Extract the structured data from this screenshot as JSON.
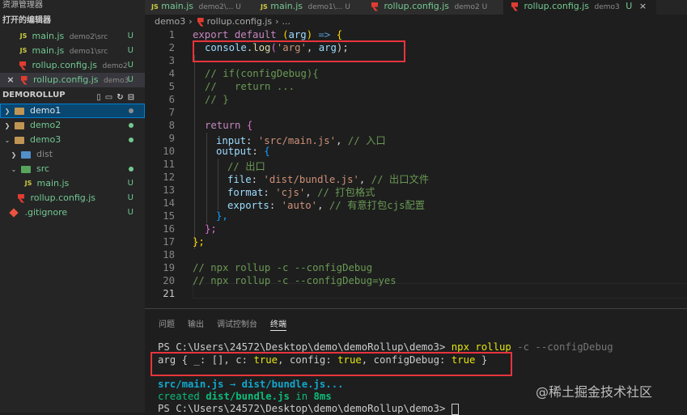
{
  "sidebar": {
    "title": "资源管理器",
    "open_editors_title": "打开的编辑器",
    "open_editors": [
      {
        "icon": "js-icon",
        "icon_text": "JS",
        "name": "main.js",
        "folder": "demo2\\src",
        "status": "U",
        "selected": false
      },
      {
        "icon": "js-icon",
        "icon_text": "JS",
        "name": "main.js",
        "folder": "demo1\\src",
        "status": "U",
        "selected": false
      },
      {
        "icon": "rollup-icon",
        "name": "rollup.config.js",
        "folder": "demo2",
        "status": "U",
        "selected": false
      },
      {
        "icon": "rollup-icon",
        "name": "rollup.config.js",
        "folder": "demo3",
        "status": "U",
        "selected": true,
        "close": "×"
      }
    ],
    "workspace_title": "DEMOROLLUP",
    "tree": [
      {
        "label": "demo1",
        "type": "folder",
        "expanded": false,
        "decoration": "dot",
        "active": true
      },
      {
        "label": "demo2",
        "type": "folder",
        "expanded": false,
        "decoration": "dot"
      },
      {
        "label": "demo3",
        "type": "folder",
        "expanded": true,
        "decoration": "dot"
      },
      {
        "label": "dist",
        "type": "folder",
        "expanded": false,
        "decoration": ""
      },
      {
        "label": "src",
        "type": "folder",
        "expanded": true,
        "decoration": "dot"
      },
      {
        "label": "main.js",
        "type": "js",
        "icon_text": "JS",
        "decoration": "U"
      },
      {
        "label": "rollup.config.js",
        "type": "rollup",
        "decoration": "U"
      },
      {
        "label": ".gitignore",
        "type": "git",
        "decoration": "U"
      }
    ]
  },
  "tabs": [
    {
      "icon_text": "JS",
      "name": "main.js",
      "folder": "demo2\\... U"
    },
    {
      "icon_text": "JS",
      "name": "main.js",
      "folder": "demo1\\... U"
    },
    {
      "name": "rollup.config.js",
      "folder": "demo2 U"
    },
    {
      "name": "rollup.config.js",
      "folder": "demo3",
      "status": "U",
      "close": "×",
      "active": true
    }
  ],
  "breadcrumb": {
    "folder": "demo3",
    "file": "rollup.config.js",
    "more": "..."
  },
  "editor": {
    "line_numbers": [
      "1",
      "2",
      "3",
      "4",
      "5",
      "6",
      "7",
      "8",
      "9",
      "10",
      "11",
      "12",
      "13",
      "14",
      "15",
      "16",
      "17",
      "18",
      "19",
      "20",
      "21"
    ],
    "current_line": "21",
    "lines": {
      "l1": {
        "export": "export",
        "default": "default",
        "paren_open": "(",
        "param": "arg",
        "paren_close": ")",
        "arrow": "=>",
        "brace": "{"
      },
      "l2": {
        "obj": "console",
        "dot": ".",
        "method": "log",
        "open": "(",
        "str": "'arg'",
        "comma": ", ",
        "arg": "arg",
        "close": ");"
      },
      "l3": "// if(configDebug){",
      "l4": "//   return ...",
      "l5": "// }",
      "l7": {
        "kw": "return",
        "brace": "{"
      },
      "l8": {
        "key": "input",
        "colon": ": ",
        "val": "'src/main.js'",
        "comma": ", ",
        "comment": "// 入口"
      },
      "l9": {
        "key": "output",
        "colon": ": ",
        "brace": "{"
      },
      "l10": "// 出口",
      "l11": {
        "key": "file",
        "colon": ": ",
        "val": "'dist/bundle.js'",
        "comma": ", ",
        "comment": "// 出口文件"
      },
      "l12": {
        "key": "format",
        "colon": ": ",
        "val": "'cjs'",
        "comma": ", ",
        "comment": "// 打包格式"
      },
      "l13": {
        "key": "exports",
        "colon": ": ",
        "val": "'auto'",
        "comma": ", ",
        "comment": "// 有意打包cjs配置"
      },
      "l14": "},",
      "l15": "};",
      "l16": "};",
      "l18": "// npx rollup -c --configDebug",
      "l19": "// npx rollup -c --configDebug=yes"
    }
  },
  "panel": {
    "tabs": [
      "问题",
      "输出",
      "调试控制台",
      "终端"
    ],
    "active_tab": "终端",
    "terminal": {
      "prompt1": "PS C:\\Users\\24572\\Desktop\\demo\\demoRollup\\demo3> ",
      "cmd": "npx rollup",
      "cmd_args": " -c --configDebug",
      "out_prefix": "arg { _: [], c: ",
      "out_true1": "true",
      "out_mid1": ", config: ",
      "out_true2": "true",
      "out_mid2": ", configDebug: ",
      "out_true3": "true",
      "out_suffix": " }",
      "bundle_src": "src/main.js",
      "bundle_arrow": " → ",
      "bundle_dest": "dist/bundle.js...",
      "created_prefix": "created ",
      "created_file": "dist/bundle.js",
      "created_mid": " in ",
      "created_time": "8ms",
      "prompt2": "PS C:\\Users\\24572\\Desktop\\demo\\demoRollup\\demo3> "
    }
  },
  "watermark": "@稀土掘金技术社区",
  "colors": {
    "highlight_box": "#e8343c",
    "accent": "#007fd4"
  }
}
